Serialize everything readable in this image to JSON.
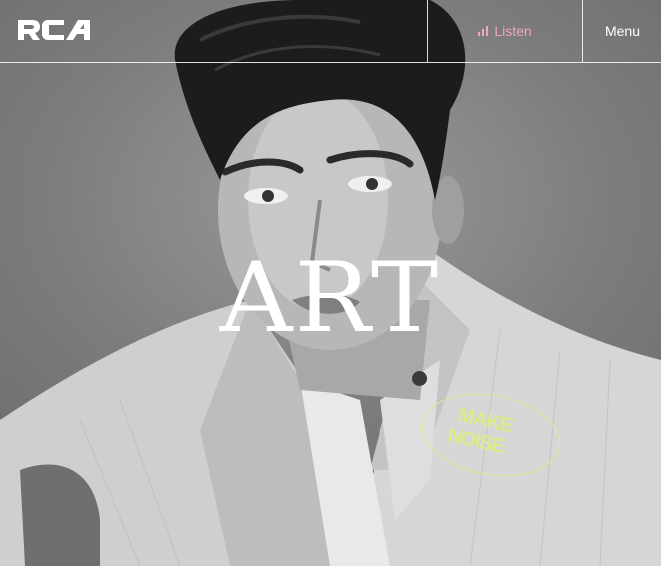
{
  "header": {
    "logo_text": "RCA",
    "listen_label": "Listen",
    "menu_label": "Menu"
  },
  "hero": {
    "headline": "ART",
    "badge_line1": "MAKE",
    "badge_line2": "NOISE"
  },
  "colors": {
    "listen": "#f3a6bf",
    "badge": "#d8ec8a",
    "headline": "#ffffff",
    "divider": "#ffffff"
  },
  "icons": {
    "listen": "equalizer-bars-icon",
    "logo": "rca-logo"
  }
}
